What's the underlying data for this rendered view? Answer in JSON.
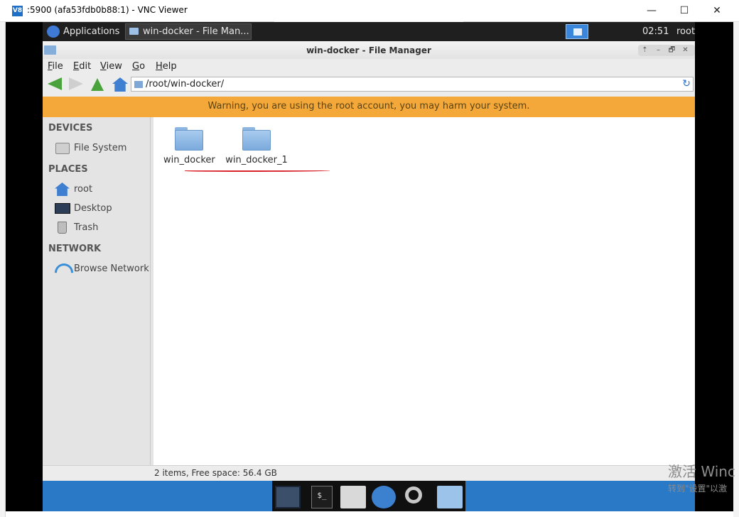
{
  "vnc": {
    "icon_text": "V8",
    "title": ":5900 (afa53fdb0b88:1) - VNC Viewer",
    "minimize": "—",
    "maximize": "☐",
    "close": "✕"
  },
  "panel": {
    "applications": "Applications",
    "taskbar_window": "win-docker - File Man...",
    "clock": "02:51",
    "user": "root"
  },
  "window": {
    "title": "win-docker - File Manager",
    "controls": {
      "up": "⇡",
      "minimize": "–",
      "maximize": "🗗",
      "close": "✕"
    }
  },
  "menu": [
    "File",
    "Edit",
    "View",
    "Go",
    "Help"
  ],
  "address": {
    "path": "/root/win-docker/",
    "reload_glyph": "↻"
  },
  "warning": "Warning, you are using the root account, you may harm your system.",
  "sidebar": {
    "devices_head": "DEVICES",
    "devices": [
      {
        "label": "File System",
        "icon": "drive-icon"
      }
    ],
    "places_head": "PLACES",
    "places": [
      {
        "label": "root",
        "icon": "home-icon"
      },
      {
        "label": "Desktop",
        "icon": "desktop-icon"
      },
      {
        "label": "Trash",
        "icon": "trash-icon"
      }
    ],
    "network_head": "NETWORK",
    "network": [
      {
        "label": "Browse Network",
        "icon": "wifi-icon"
      }
    ]
  },
  "files": [
    {
      "name": "win_docker",
      "type": "folder"
    },
    {
      "name": "win_docker_1",
      "type": "folder"
    }
  ],
  "status": "2 items, Free space: 56.4 GB",
  "dock": {
    "terminal_glyph": "$_"
  },
  "activation": {
    "line1": "激活 Winc",
    "line2": "转到\"设置\"以激"
  },
  "colors": {
    "warning": "#f4a83a",
    "desktop": "#2a79c7",
    "panel": "#1f1f1f",
    "annotation": "#d8232a"
  }
}
